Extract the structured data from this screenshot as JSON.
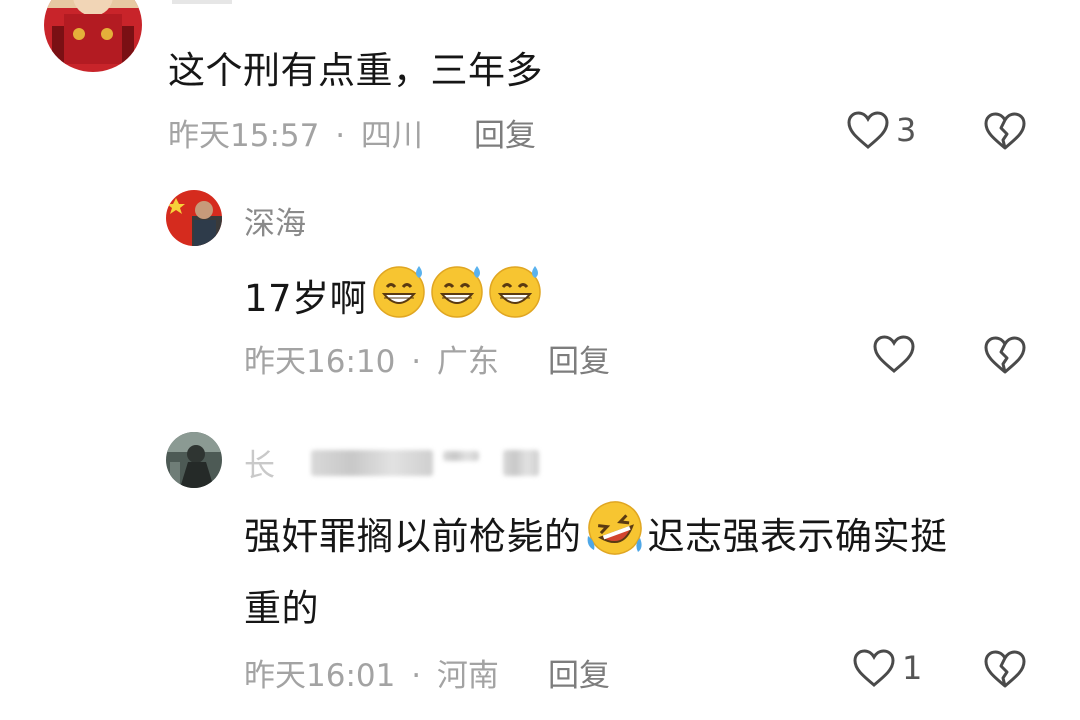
{
  "comment1": {
    "text": "这个刑有点重，三年多",
    "time": "昨天15:57",
    "sep": "·",
    "location": "四川",
    "reply_label": "回复",
    "like_count": "3"
  },
  "reply1": {
    "author": "深海",
    "text": "17岁啊",
    "emojis": [
      "grin-sweat-emoji",
      "grin-sweat-emoji",
      "grin-sweat-emoji"
    ],
    "time": "昨天16:10",
    "sep": "·",
    "location": "广东",
    "reply_label": "回复",
    "like_count": ""
  },
  "reply2": {
    "author_visible": "长",
    "text_part1": "强奸罪搁以前枪毙的",
    "emoji": "rolling-laugh-emoji",
    "text_part2": "迟志强表示确实挺",
    "text_line2": "重的",
    "time": "昨天16:01",
    "sep": "·",
    "location": "河南",
    "reply_label": "回复",
    "like_count": "1"
  },
  "colors": {
    "meta_gray": "#a3a3a3",
    "name_gray": "#8a8a8a",
    "emoji_yellow": "#f7c531"
  }
}
